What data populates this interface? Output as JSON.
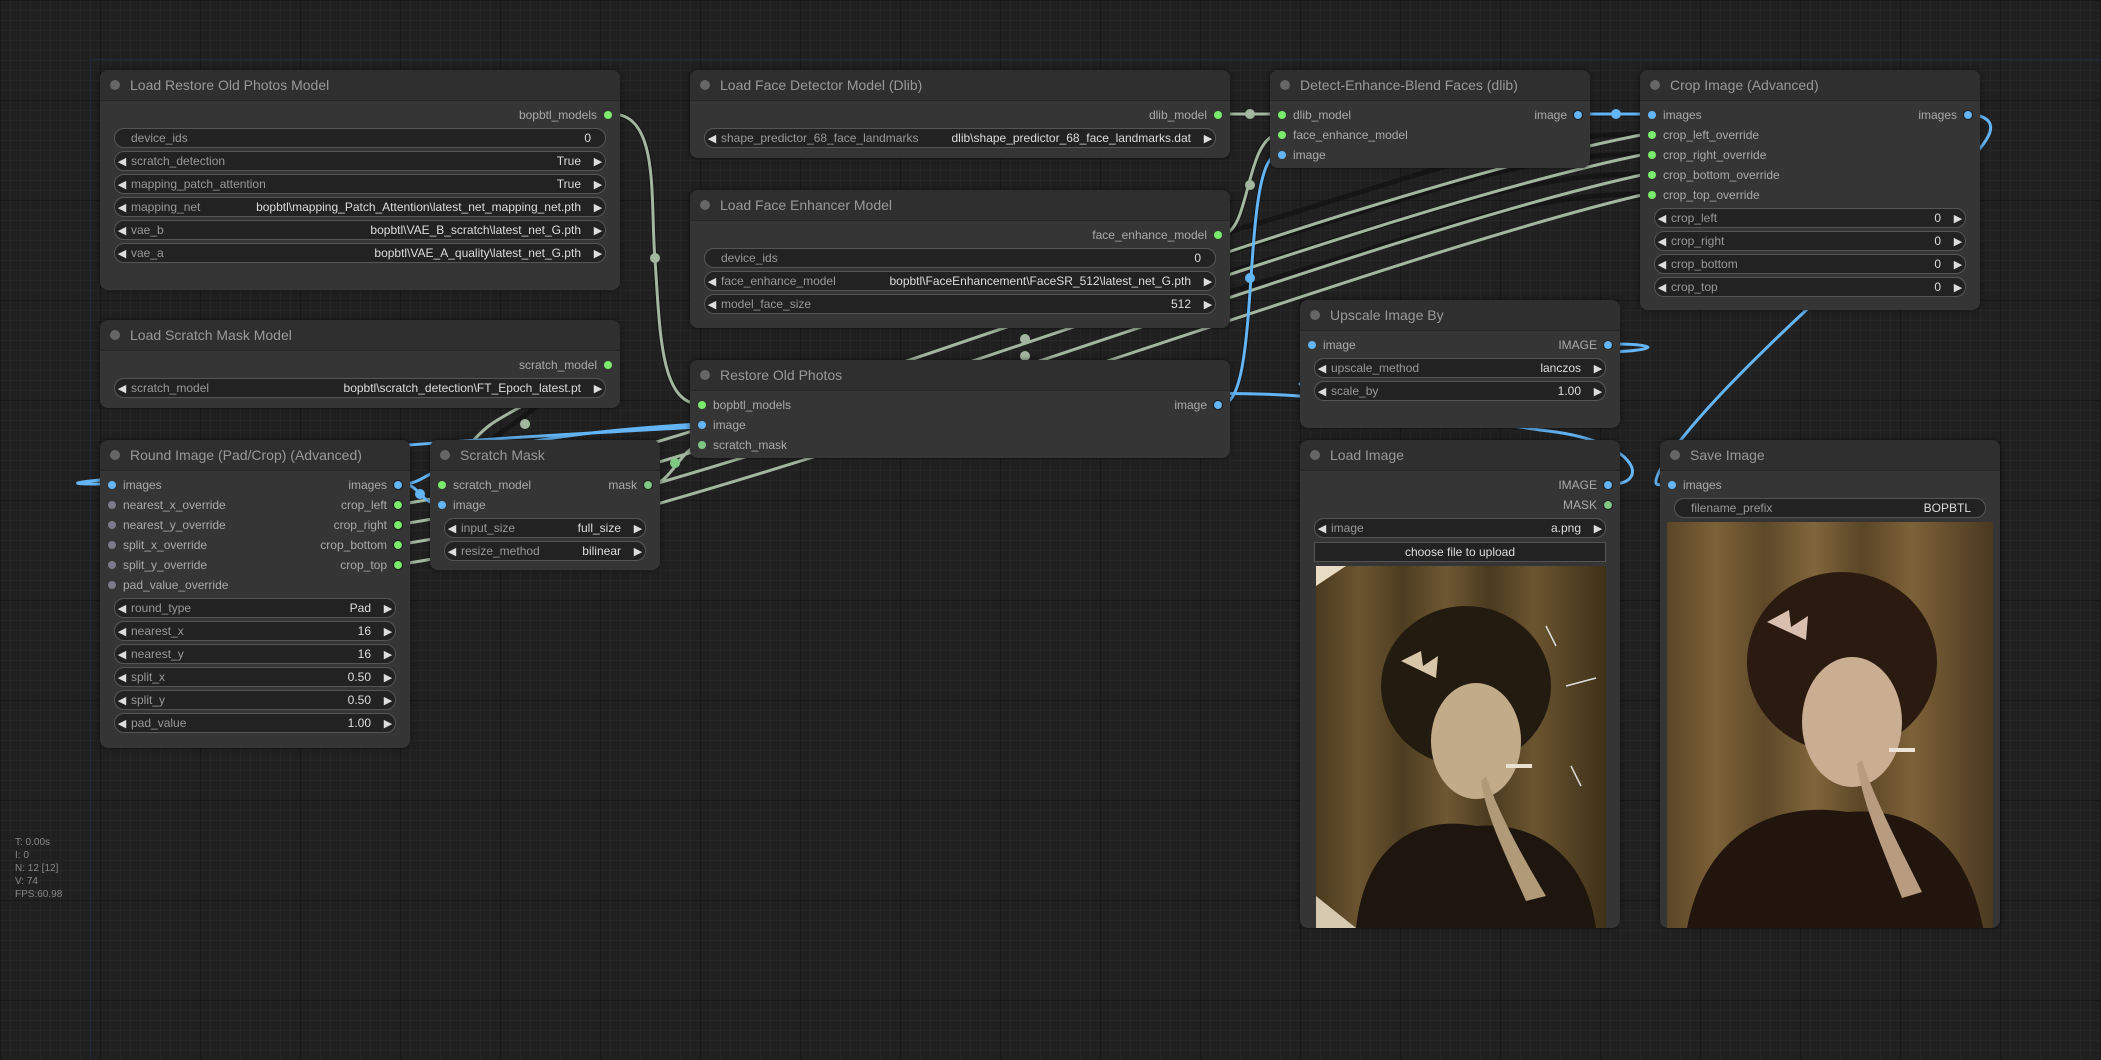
{
  "colors": {
    "model_link": "#a3b7a0",
    "image_link": "#64b5f6",
    "model_slot": "#7aeb6c",
    "image_slot": "#64b5f6",
    "mask_slot": "#81c784",
    "optional_slot": "#7a7a8a"
  },
  "nodes": {
    "load_restore": {
      "title": "Load Restore Old Photos Model",
      "outputs": [
        "bopbtl_models"
      ],
      "widgets": [
        {
          "label": "device_ids",
          "value": "0"
        },
        {
          "label": "scratch_detection",
          "value": "True"
        },
        {
          "label": "mapping_patch_attention",
          "value": "True"
        },
        {
          "label": "mapping_net",
          "value": "bopbtl\\mapping_Patch_Attention\\latest_net_mapping_net.pth"
        },
        {
          "label": "vae_b",
          "value": "bopbtl\\VAE_B_scratch\\latest_net_G.pth"
        },
        {
          "label": "vae_a",
          "value": "bopbtl\\VAE_A_quality\\latest_net_G.pth"
        }
      ]
    },
    "load_scratch": {
      "title": "Load Scratch Mask Model",
      "outputs": [
        "scratch_model"
      ],
      "widgets": [
        {
          "label": "scratch_model",
          "value": "bopbtl\\scratch_detection\\FT_Epoch_latest.pt"
        }
      ]
    },
    "round_image": {
      "title": "Round Image (Pad/Crop) (Advanced)",
      "inputs": [
        "images",
        "nearest_x_override",
        "nearest_y_override",
        "split_x_override",
        "split_y_override",
        "pad_value_override"
      ],
      "outputs": [
        "images",
        "crop_left",
        "crop_right",
        "crop_bottom",
        "crop_top"
      ],
      "widgets": [
        {
          "label": "round_type",
          "value": "Pad"
        },
        {
          "label": "nearest_x",
          "value": "16"
        },
        {
          "label": "nearest_y",
          "value": "16"
        },
        {
          "label": "split_x",
          "value": "0.50"
        },
        {
          "label": "split_y",
          "value": "0.50"
        },
        {
          "label": "pad_value",
          "value": "1.00"
        }
      ]
    },
    "scratch_mask": {
      "title": "Scratch Mask",
      "inputs": [
        "scratch_model",
        "image"
      ],
      "outputs": [
        "mask"
      ],
      "widgets": [
        {
          "label": "input_size",
          "value": "full_size"
        },
        {
          "label": "resize_method",
          "value": "bilinear"
        }
      ]
    },
    "face_detector": {
      "title": "Load Face Detector Model (Dlib)",
      "outputs": [
        "dlib_model"
      ],
      "widgets": [
        {
          "label": "shape_predictor_68_face_landmarks",
          "value": "dlib\\shape_predictor_68_face_landmarks.dat"
        }
      ]
    },
    "face_enhancer": {
      "title": "Load Face Enhancer Model",
      "outputs": [
        "face_enhance_model"
      ],
      "widgets": [
        {
          "label": "device_ids",
          "value": "0"
        },
        {
          "label": "face_enhance_model",
          "value": "bopbtl\\FaceEnhancement\\FaceSR_512\\latest_net_G.pth"
        },
        {
          "label": "model_face_size",
          "value": "512"
        }
      ]
    },
    "restore": {
      "title": "Restore Old Photos",
      "inputs": [
        "bopbtl_models",
        "image",
        "scratch_mask"
      ],
      "outputs": [
        "image"
      ]
    },
    "blend_faces": {
      "title": "Detect-Enhance-Blend Faces (dlib)",
      "inputs": [
        "dlib_model",
        "face_enhance_model",
        "image"
      ],
      "outputs": [
        "image"
      ]
    },
    "crop_image": {
      "title": "Crop Image (Advanced)",
      "inputs": [
        "images",
        "crop_left_override",
        "crop_right_override",
        "crop_bottom_override",
        "crop_top_override"
      ],
      "outputs": [
        "images"
      ],
      "widgets": [
        {
          "label": "crop_left",
          "value": "0"
        },
        {
          "label": "crop_right",
          "value": "0"
        },
        {
          "label": "crop_bottom",
          "value": "0"
        },
        {
          "label": "crop_top",
          "value": "0"
        }
      ]
    },
    "upscale": {
      "title": "Upscale Image By",
      "inputs": [
        "image"
      ],
      "outputs": [
        "IMAGE"
      ],
      "widgets": [
        {
          "label": "upscale_method",
          "value": "lanczos"
        },
        {
          "label": "scale_by",
          "value": "1.00"
        }
      ]
    },
    "load_image": {
      "title": "Load Image",
      "outputs": [
        "IMAGE",
        "MASK"
      ],
      "widgets": [
        {
          "label": "image",
          "value": "a.png"
        }
      ],
      "upload_label": "choose file to upload",
      "preview": "old scratched sepia portrait"
    },
    "save_image": {
      "title": "Save Image",
      "inputs": [
        "images"
      ],
      "widgets": [
        {
          "label": "filename_prefix",
          "value": "BOPBTL"
        }
      ],
      "preview": "restored sepia portrait"
    }
  },
  "stats": {
    "t": "T: 0.00s",
    "i": "I: 0",
    "n": "N: 12 [12]",
    "v": "V: 74",
    "fps": "FPS:60.98"
  }
}
